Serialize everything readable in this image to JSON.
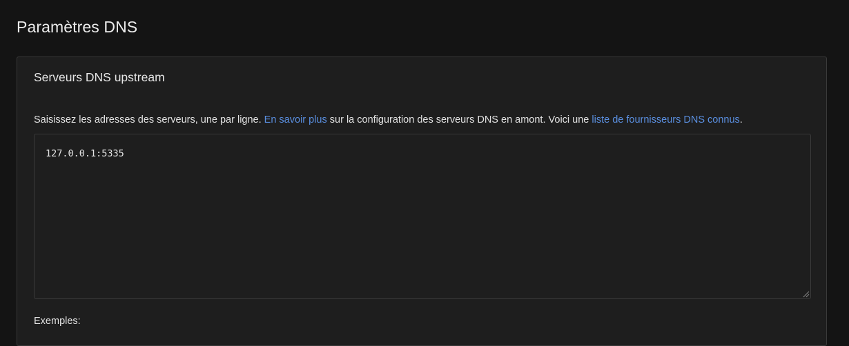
{
  "header": {
    "title": "Paramètres DNS"
  },
  "upstream": {
    "title": "Serveurs DNS upstream",
    "description": {
      "part1": "Saisissez les adresses des serveurs, une par ligne. ",
      "link1": "En savoir plus",
      "part2": " sur la configuration des serveurs DNS en amont. Voici une ",
      "link2": "liste de fournisseurs DNS connus",
      "part3": "."
    },
    "servers_value": "127.0.0.1:5335",
    "examples_label": "Exemples:"
  },
  "colors": {
    "background": "#141414",
    "card": "#1e1e1e",
    "border": "#3a3a3a",
    "link": "#5a8fe0",
    "text": "#e6e6e6"
  },
  "icons": {
    "resize_handle": "resize-grip-icon"
  }
}
